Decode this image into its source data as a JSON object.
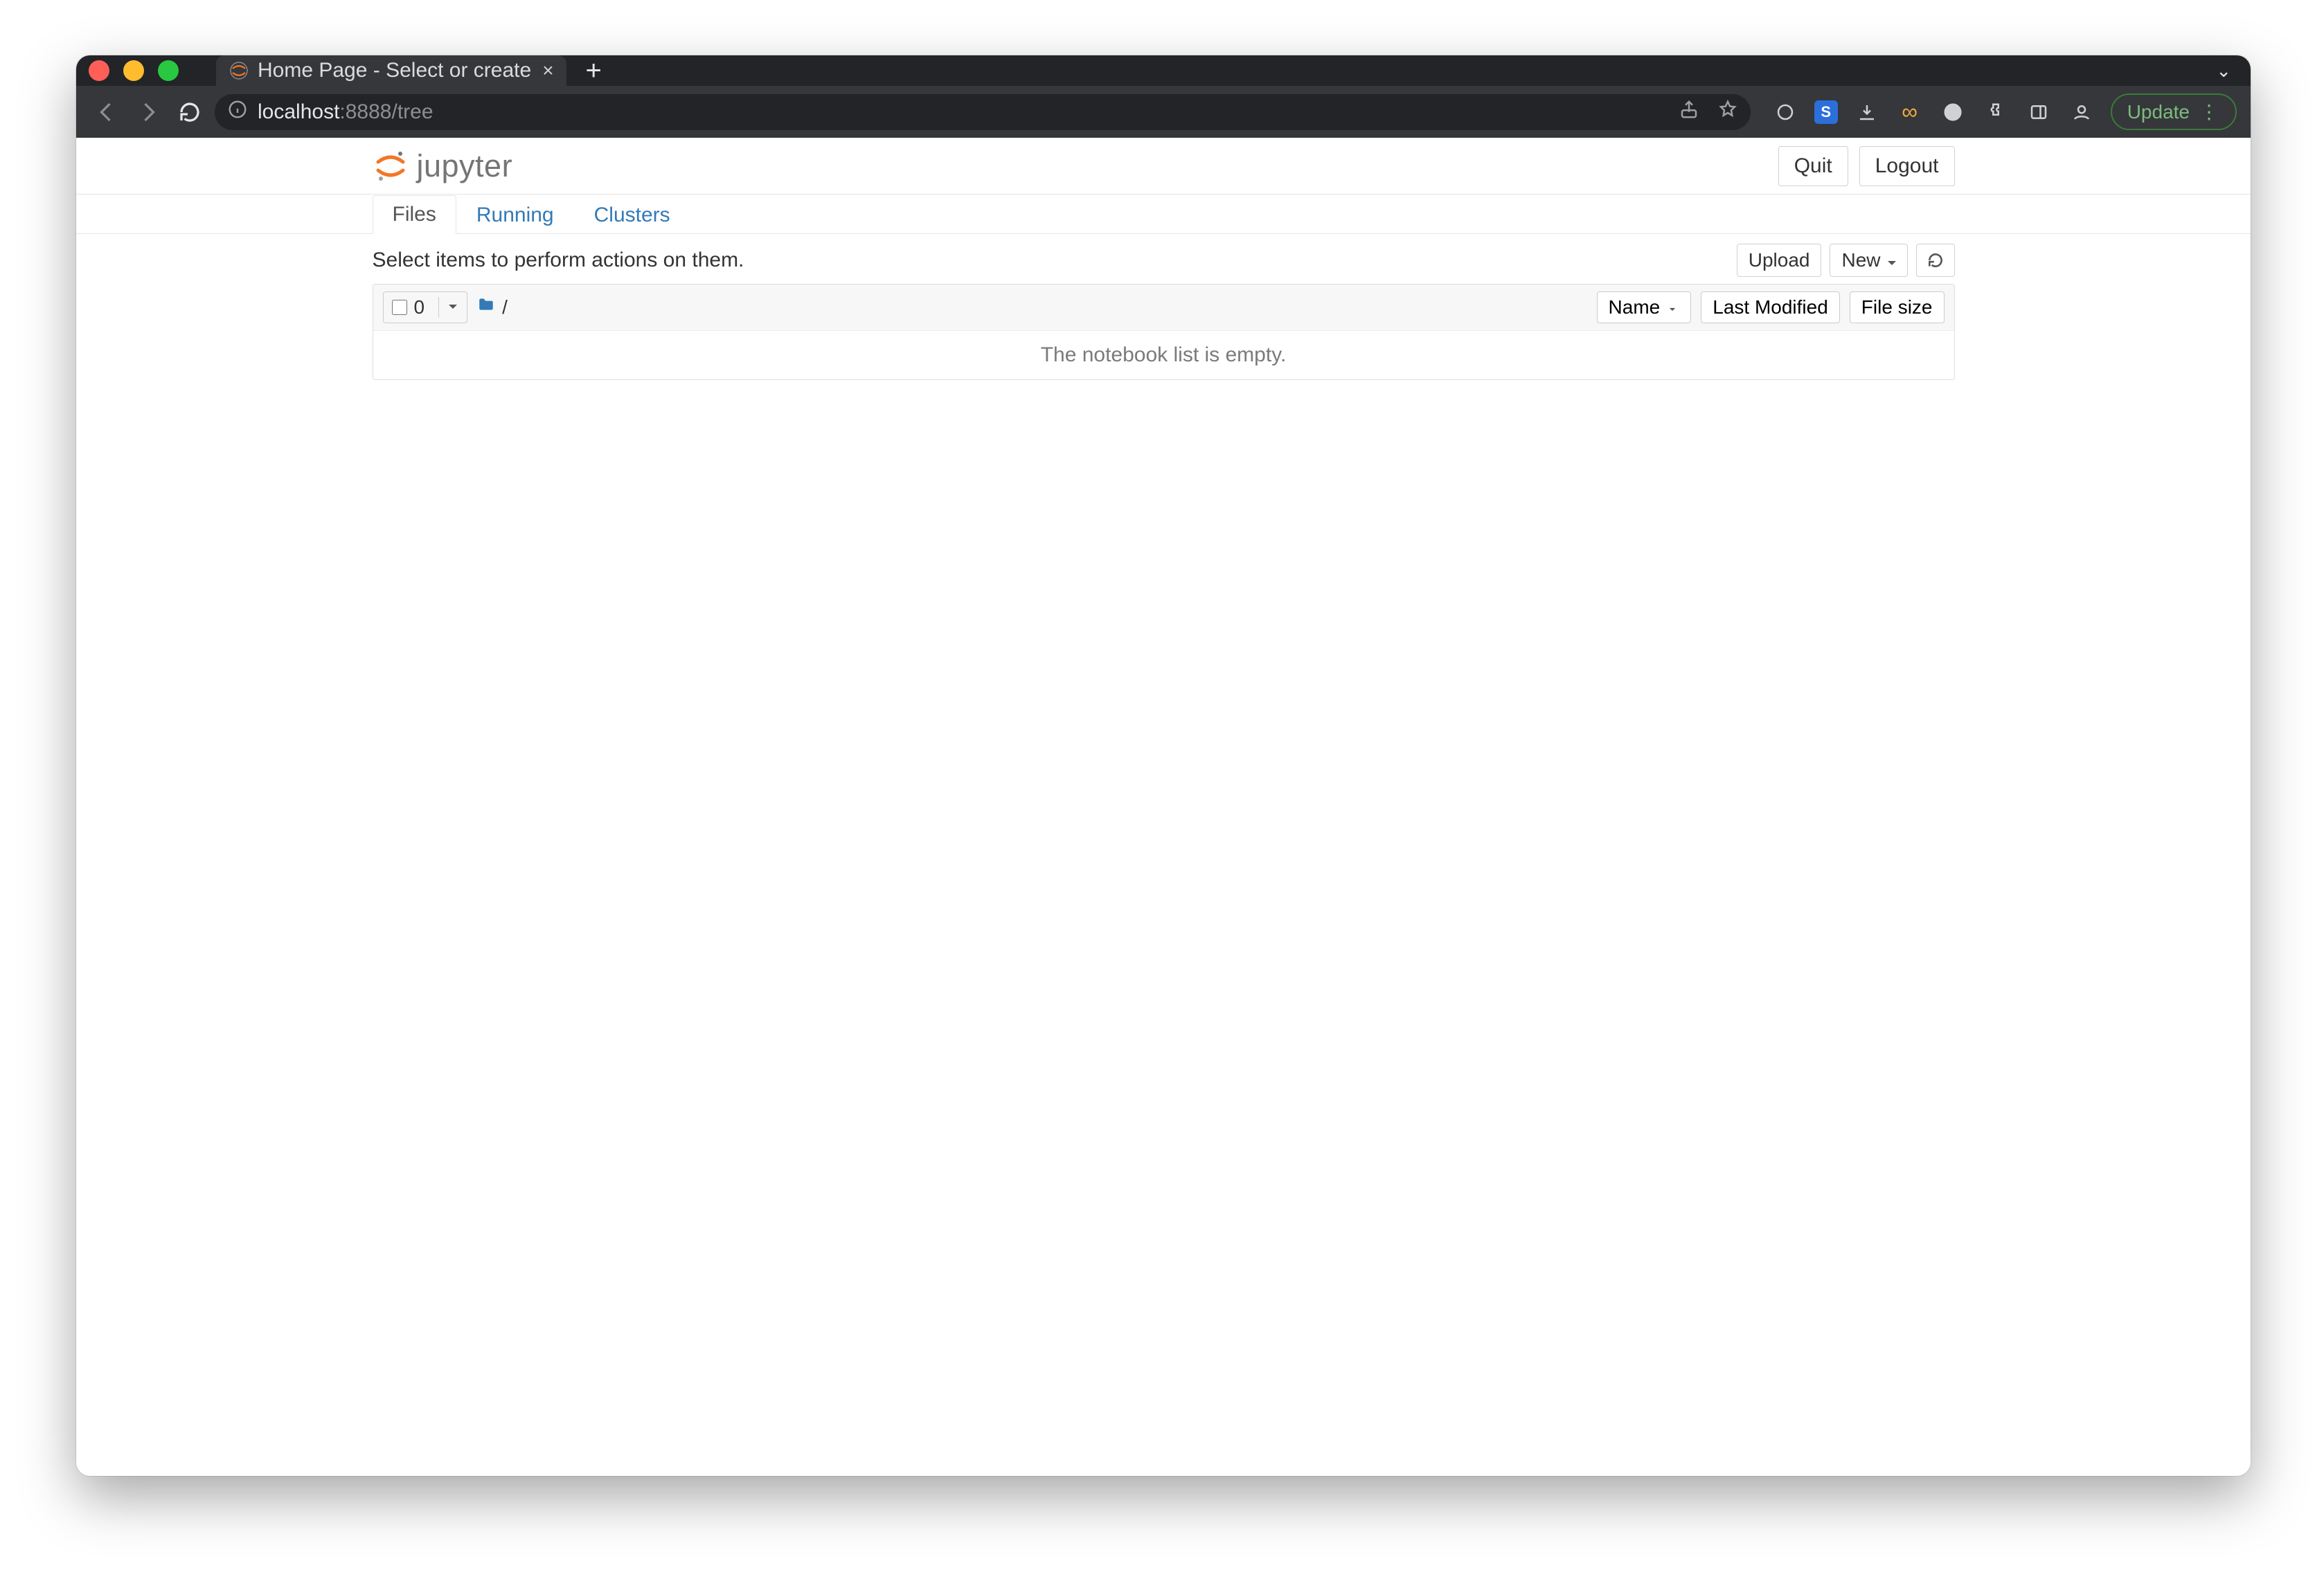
{
  "browser": {
    "tab_title": "Home Page - Select or create",
    "url_host": "localhost",
    "url_rest": ":8888/tree",
    "update_label": "Update"
  },
  "header": {
    "logo_word": "jupyter",
    "quit": "Quit",
    "logout": "Logout"
  },
  "tabs": {
    "files": "Files",
    "running": "Running",
    "clusters": "Clusters"
  },
  "toolbar": {
    "hint": "Select items to perform actions on them.",
    "upload": "Upload",
    "new": "New"
  },
  "list": {
    "selected_count": "0",
    "breadcrumb": "/",
    "sort_name": "Name",
    "sort_modified": "Last Modified",
    "sort_size": "File size",
    "empty": "The notebook list is empty."
  }
}
